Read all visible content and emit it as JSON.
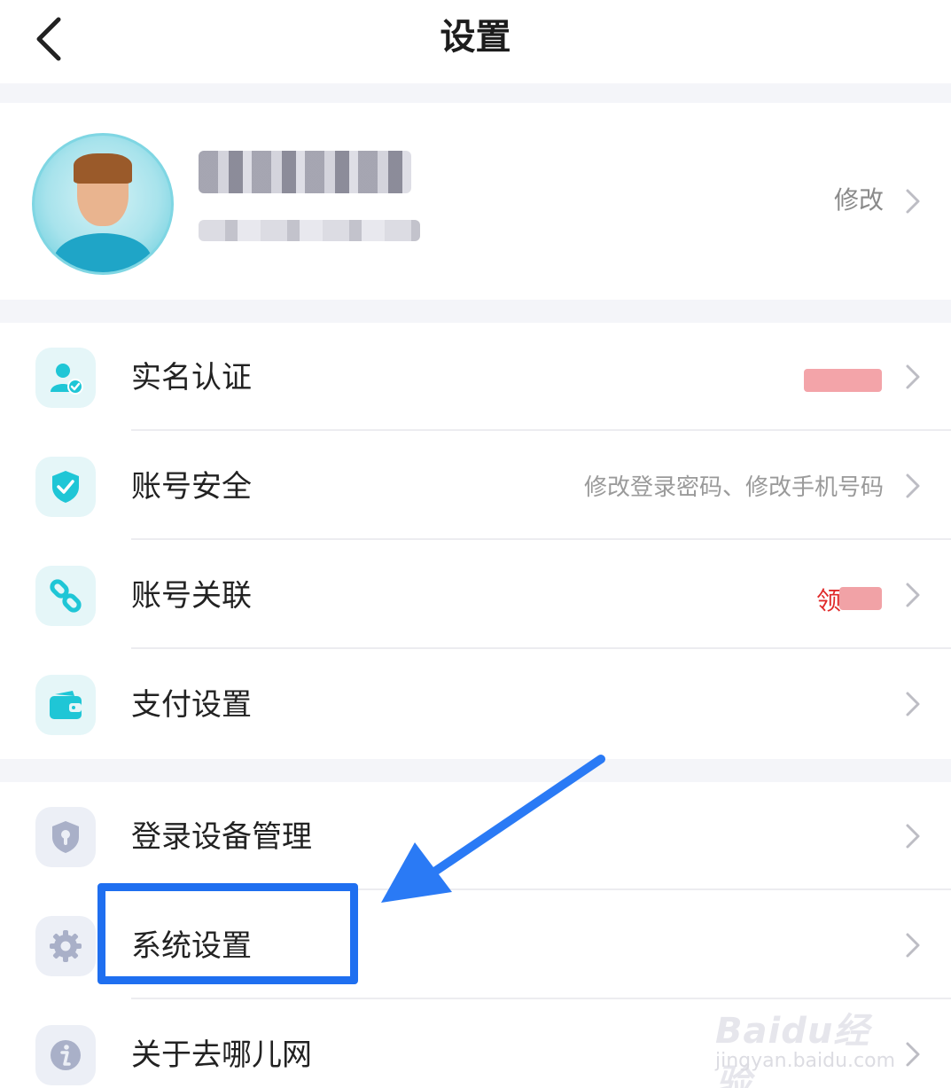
{
  "header": {
    "title": "设置",
    "back_icon": "chevron-left-icon"
  },
  "profile": {
    "edit_label": "修改"
  },
  "group1": [
    {
      "label": "实名认证",
      "icon": "user-verified-icon",
      "value": ""
    },
    {
      "label": "账号安全",
      "icon": "shield-check-icon",
      "value": "修改登录密码、修改手机号码"
    },
    {
      "label": "账号关联",
      "icon": "link-icon",
      "value": "领"
    },
    {
      "label": "支付设置",
      "icon": "wallet-icon",
      "value": ""
    }
  ],
  "group2": [
    {
      "label": "登录设备管理",
      "icon": "shield-lock-icon"
    },
    {
      "label": "系统设置",
      "icon": "gear-icon"
    },
    {
      "label": "关于去哪儿网",
      "icon": "info-icon"
    }
  ],
  "watermark": {
    "logo": "Baidu经验",
    "url": "jingyan.baidu.com"
  },
  "colors": {
    "accent_teal": "#1fc6d6",
    "highlight_blue": "#1f6ff0",
    "icon_gray": "#a9b0c8"
  }
}
